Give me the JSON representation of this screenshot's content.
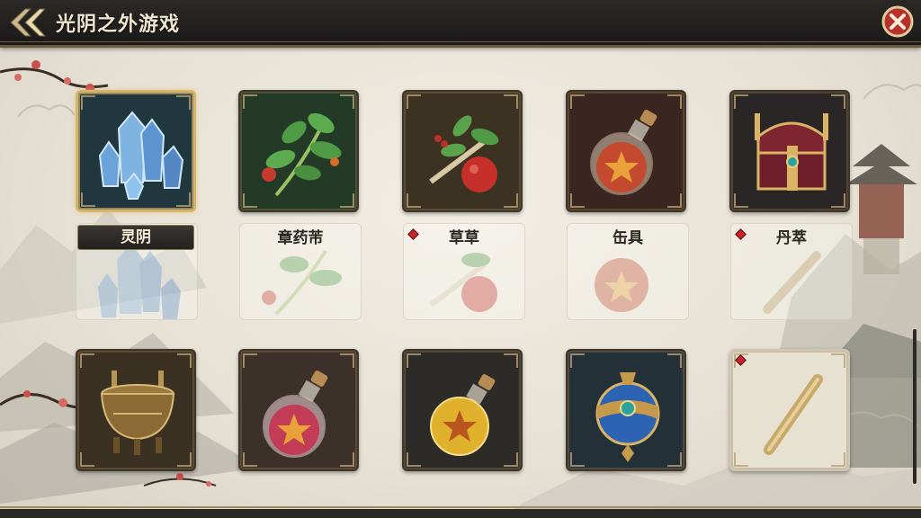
{
  "header": {
    "title": "光阴之外游戏"
  },
  "items": [
    {
      "id": "crystal",
      "label": "灵阴",
      "selected": true,
      "icon": "blue-crystal-icon",
      "gem": false,
      "bg": "#20383d"
    },
    {
      "id": "herb-branch",
      "label": "章药芾",
      "selected": false,
      "icon": "herb-branch-icon",
      "gem": false,
      "bg": "#223a26"
    },
    {
      "id": "herb-fruit",
      "label": "草草",
      "selected": false,
      "icon": "tomato-herb-icon",
      "gem": true,
      "bg": "#3b3222"
    },
    {
      "id": "red-potion",
      "label": "缶具",
      "selected": false,
      "icon": "red-potion-icon",
      "gem": false,
      "bg": "#3a2520"
    },
    {
      "id": "treasure-chest",
      "label": "丹萃",
      "selected": false,
      "icon": "treasure-chest-icon",
      "gem": true,
      "bg": "#2a2625"
    },
    {
      "id": "bronze-cauldron",
      "label": "",
      "selected": false,
      "icon": "bronze-cauldron-icon",
      "gem": false,
      "bg": "#3a3123"
    },
    {
      "id": "pink-potion",
      "label": "",
      "selected": false,
      "icon": "pink-potion-icon",
      "gem": false,
      "bg": "#3b302a"
    },
    {
      "id": "gold-potion",
      "label": "",
      "selected": false,
      "icon": "gold-potion-icon",
      "gem": false,
      "bg": "#2d2b27"
    },
    {
      "id": "blue-amulet",
      "label": "",
      "selected": false,
      "icon": "blue-amulet-icon",
      "gem": false,
      "bg": "#243038"
    },
    {
      "id": "bone-scroll",
      "label": "",
      "selected": false,
      "icon": "bone-scroll-icon",
      "gem": true,
      "bg": "#e7e1d2"
    }
  ],
  "colors": {
    "header_bg": "#1f1e1b",
    "gold_frame": "#d9b466",
    "red_gem": "#c8232b"
  }
}
